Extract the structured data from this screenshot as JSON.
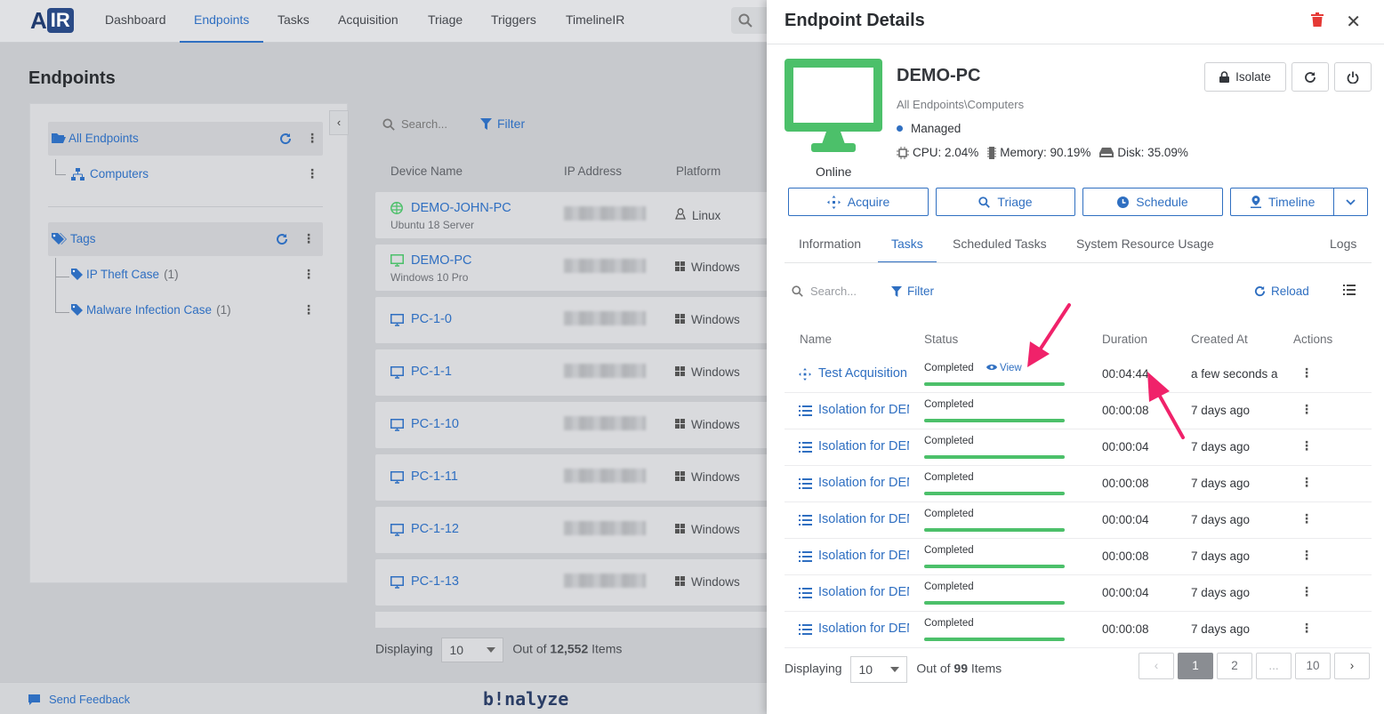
{
  "nav": {
    "logo_a": "A",
    "logo_ir": "IR",
    "items": [
      "Dashboard",
      "Endpoints",
      "Tasks",
      "Acquisition",
      "Triage",
      "Triggers",
      "TimelineIR"
    ],
    "active": "Endpoints"
  },
  "page_title": "Endpoints",
  "tree": {
    "all_endpoints": "All Endpoints",
    "computers": "Computers",
    "tags_label": "Tags",
    "tags": [
      {
        "label": "IP Theft Case",
        "count": "(1)"
      },
      {
        "label": "Malware Infection Case",
        "count": "(1)"
      }
    ]
  },
  "list": {
    "search_placeholder": "Search...",
    "filter_label": "Filter",
    "columns": [
      "Device Name",
      "IP Address",
      "Platform"
    ],
    "rows": [
      {
        "name": "DEMO-JOHN-PC",
        "sub": "Ubuntu 18 Server",
        "platform": "Linux",
        "icon": "server-icon"
      },
      {
        "name": "DEMO-PC",
        "sub": "Windows 10 Pro",
        "platform": "Windows",
        "icon": "monitor-icon"
      },
      {
        "name": "PC-1-0",
        "sub": "",
        "platform": "Windows",
        "icon": "monitor-icon"
      },
      {
        "name": "PC-1-1",
        "sub": "",
        "platform": "Windows",
        "icon": "monitor-icon"
      },
      {
        "name": "PC-1-10",
        "sub": "",
        "platform": "Windows",
        "icon": "monitor-icon"
      },
      {
        "name": "PC-1-11",
        "sub": "",
        "platform": "Windows",
        "icon": "monitor-icon"
      },
      {
        "name": "PC-1-12",
        "sub": "",
        "platform": "Windows",
        "icon": "monitor-icon"
      },
      {
        "name": "PC-1-13",
        "sub": "",
        "platform": "Windows",
        "icon": "monitor-icon"
      }
    ],
    "displaying_label": "Displaying",
    "page_size": "10",
    "out_of_label": "Out of",
    "total": "12,552",
    "items_label": "Items"
  },
  "footer": {
    "feedback": "Send Feedback",
    "brand": "b!nalyze"
  },
  "drawer": {
    "title": "Endpoint Details",
    "status": "Online",
    "pc_name": "DEMO-PC",
    "path": "All Endpoints\\Computers",
    "managed": "Managed",
    "cpu": "CPU: 2.04%",
    "memory": "Memory: 90.19%",
    "disk": "Disk: 35.09%",
    "isolate_label": "Isolate",
    "actions": [
      "Acquire",
      "Triage",
      "Schedule",
      "Timeline"
    ],
    "tabs": [
      "Information",
      "Tasks",
      "Scheduled Tasks",
      "System Resource Usage",
      "Logs"
    ],
    "active_tab": "Tasks",
    "search_placeholder": "Search...",
    "filter_label": "Filter",
    "reload_label": "Reload",
    "columns": [
      "Name",
      "Status",
      "Duration",
      "Created At",
      "Actions"
    ],
    "tasks": [
      {
        "name": "Test Acquisition",
        "status": "Completed",
        "view": "View",
        "duration": "00:04:44",
        "created": "a few seconds ago",
        "icon": "acquire-icon",
        "progress": 1.0
      },
      {
        "name": "Isolation for DEMO-PC",
        "status": "Completed",
        "view": "",
        "duration": "00:00:08",
        "created": "7 days ago",
        "icon": "list-icon",
        "progress": 1.0
      },
      {
        "name": "Isolation for DEMO-PC",
        "status": "Completed",
        "view": "",
        "duration": "00:00:04",
        "created": "7 days ago",
        "icon": "list-icon",
        "progress": 1.0
      },
      {
        "name": "Isolation for DEMO-PC",
        "status": "Completed",
        "view": "",
        "duration": "00:00:08",
        "created": "7 days ago",
        "icon": "list-icon",
        "progress": 1.0
      },
      {
        "name": "Isolation for DEMO-PC",
        "status": "Completed",
        "view": "",
        "duration": "00:00:04",
        "created": "7 days ago",
        "icon": "list-icon",
        "progress": 1.0
      },
      {
        "name": "Isolation for DEMO-PC",
        "status": "Completed",
        "view": "",
        "duration": "00:00:08",
        "created": "7 days ago",
        "icon": "list-icon",
        "progress": 1.0
      },
      {
        "name": "Isolation for DEMO-PC",
        "status": "Completed",
        "view": "",
        "duration": "00:00:04",
        "created": "7 days ago",
        "icon": "list-icon",
        "progress": 1.0
      },
      {
        "name": "Isolation for DEMO-PC",
        "status": "Completed",
        "view": "",
        "duration": "00:00:08",
        "created": "7 days ago",
        "icon": "list-icon",
        "progress": 1.0
      }
    ],
    "displaying_label": "Displaying",
    "page_size": "10",
    "out_of_label": "Out of",
    "total": "99",
    "items_label": "Items",
    "pages": [
      "1",
      "2",
      "...",
      "10"
    ],
    "current_page": "1"
  },
  "colors": {
    "accent": "#2f6fc1",
    "online_green": "#4cc06a",
    "annotation_pink": "#f0226a",
    "delete_red": "#e53935"
  }
}
